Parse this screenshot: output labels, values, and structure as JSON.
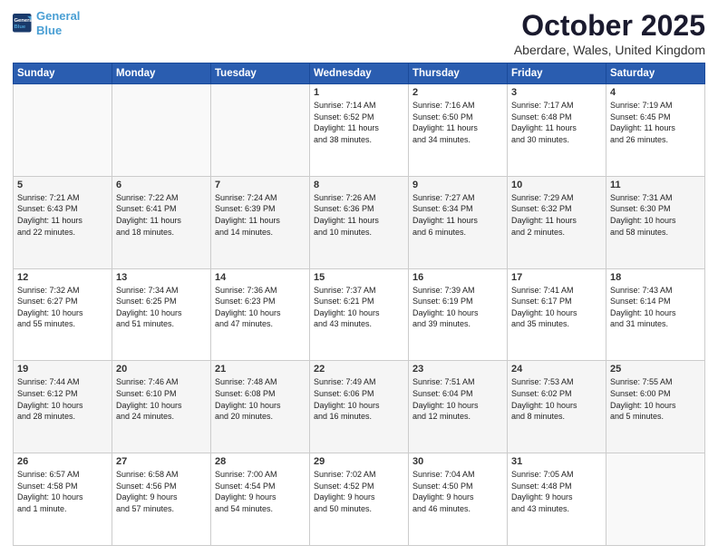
{
  "logo": {
    "line1": "General",
    "line2": "Blue"
  },
  "title": "October 2025",
  "location": "Aberdare, Wales, United Kingdom",
  "days_header": [
    "Sunday",
    "Monday",
    "Tuesday",
    "Wednesday",
    "Thursday",
    "Friday",
    "Saturday"
  ],
  "weeks": [
    [
      {
        "num": "",
        "info": ""
      },
      {
        "num": "",
        "info": ""
      },
      {
        "num": "",
        "info": ""
      },
      {
        "num": "1",
        "info": "Sunrise: 7:14 AM\nSunset: 6:52 PM\nDaylight: 11 hours\nand 38 minutes."
      },
      {
        "num": "2",
        "info": "Sunrise: 7:16 AM\nSunset: 6:50 PM\nDaylight: 11 hours\nand 34 minutes."
      },
      {
        "num": "3",
        "info": "Sunrise: 7:17 AM\nSunset: 6:48 PM\nDaylight: 11 hours\nand 30 minutes."
      },
      {
        "num": "4",
        "info": "Sunrise: 7:19 AM\nSunset: 6:45 PM\nDaylight: 11 hours\nand 26 minutes."
      }
    ],
    [
      {
        "num": "5",
        "info": "Sunrise: 7:21 AM\nSunset: 6:43 PM\nDaylight: 11 hours\nand 22 minutes."
      },
      {
        "num": "6",
        "info": "Sunrise: 7:22 AM\nSunset: 6:41 PM\nDaylight: 11 hours\nand 18 minutes."
      },
      {
        "num": "7",
        "info": "Sunrise: 7:24 AM\nSunset: 6:39 PM\nDaylight: 11 hours\nand 14 minutes."
      },
      {
        "num": "8",
        "info": "Sunrise: 7:26 AM\nSunset: 6:36 PM\nDaylight: 11 hours\nand 10 minutes."
      },
      {
        "num": "9",
        "info": "Sunrise: 7:27 AM\nSunset: 6:34 PM\nDaylight: 11 hours\nand 6 minutes."
      },
      {
        "num": "10",
        "info": "Sunrise: 7:29 AM\nSunset: 6:32 PM\nDaylight: 11 hours\nand 2 minutes."
      },
      {
        "num": "11",
        "info": "Sunrise: 7:31 AM\nSunset: 6:30 PM\nDaylight: 10 hours\nand 58 minutes."
      }
    ],
    [
      {
        "num": "12",
        "info": "Sunrise: 7:32 AM\nSunset: 6:27 PM\nDaylight: 10 hours\nand 55 minutes."
      },
      {
        "num": "13",
        "info": "Sunrise: 7:34 AM\nSunset: 6:25 PM\nDaylight: 10 hours\nand 51 minutes."
      },
      {
        "num": "14",
        "info": "Sunrise: 7:36 AM\nSunset: 6:23 PM\nDaylight: 10 hours\nand 47 minutes."
      },
      {
        "num": "15",
        "info": "Sunrise: 7:37 AM\nSunset: 6:21 PM\nDaylight: 10 hours\nand 43 minutes."
      },
      {
        "num": "16",
        "info": "Sunrise: 7:39 AM\nSunset: 6:19 PM\nDaylight: 10 hours\nand 39 minutes."
      },
      {
        "num": "17",
        "info": "Sunrise: 7:41 AM\nSunset: 6:17 PM\nDaylight: 10 hours\nand 35 minutes."
      },
      {
        "num": "18",
        "info": "Sunrise: 7:43 AM\nSunset: 6:14 PM\nDaylight: 10 hours\nand 31 minutes."
      }
    ],
    [
      {
        "num": "19",
        "info": "Sunrise: 7:44 AM\nSunset: 6:12 PM\nDaylight: 10 hours\nand 28 minutes."
      },
      {
        "num": "20",
        "info": "Sunrise: 7:46 AM\nSunset: 6:10 PM\nDaylight: 10 hours\nand 24 minutes."
      },
      {
        "num": "21",
        "info": "Sunrise: 7:48 AM\nSunset: 6:08 PM\nDaylight: 10 hours\nand 20 minutes."
      },
      {
        "num": "22",
        "info": "Sunrise: 7:49 AM\nSunset: 6:06 PM\nDaylight: 10 hours\nand 16 minutes."
      },
      {
        "num": "23",
        "info": "Sunrise: 7:51 AM\nSunset: 6:04 PM\nDaylight: 10 hours\nand 12 minutes."
      },
      {
        "num": "24",
        "info": "Sunrise: 7:53 AM\nSunset: 6:02 PM\nDaylight: 10 hours\nand 8 minutes."
      },
      {
        "num": "25",
        "info": "Sunrise: 7:55 AM\nSunset: 6:00 PM\nDaylight: 10 hours\nand 5 minutes."
      }
    ],
    [
      {
        "num": "26",
        "info": "Sunrise: 6:57 AM\nSunset: 4:58 PM\nDaylight: 10 hours\nand 1 minute."
      },
      {
        "num": "27",
        "info": "Sunrise: 6:58 AM\nSunset: 4:56 PM\nDaylight: 9 hours\nand 57 minutes."
      },
      {
        "num": "28",
        "info": "Sunrise: 7:00 AM\nSunset: 4:54 PM\nDaylight: 9 hours\nand 54 minutes."
      },
      {
        "num": "29",
        "info": "Sunrise: 7:02 AM\nSunset: 4:52 PM\nDaylight: 9 hours\nand 50 minutes."
      },
      {
        "num": "30",
        "info": "Sunrise: 7:04 AM\nSunset: 4:50 PM\nDaylight: 9 hours\nand 46 minutes."
      },
      {
        "num": "31",
        "info": "Sunrise: 7:05 AM\nSunset: 4:48 PM\nDaylight: 9 hours\nand 43 minutes."
      },
      {
        "num": "",
        "info": ""
      }
    ]
  ]
}
